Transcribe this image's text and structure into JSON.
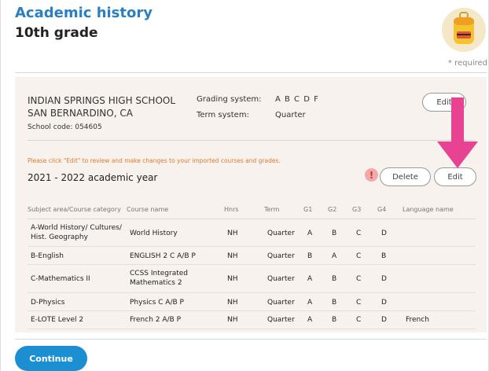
{
  "header": {
    "title": "Academic history",
    "subtitle": "10th grade",
    "required_note": "* required"
  },
  "school": {
    "name": "INDIAN SPRINGS HIGH SCHOOL",
    "city": "SAN BERNARDINO, CA",
    "code": "School code: 054605",
    "grading_label": "Grading system:",
    "grading_value": "A B C D F",
    "term_label": "Term system:",
    "term_value": "Quarter",
    "edit_label": "Edit"
  },
  "notice": "Please click \"Edit\" to review and make changes to your imported courses and grades.",
  "year": {
    "title": "2021 - 2022 academic year",
    "warning_icon": "!",
    "delete_label": "Delete",
    "edit_label": "Edit"
  },
  "table": {
    "headers": [
      "Subject area/Course category",
      "Course name",
      "Hnrs",
      "Term",
      "G1",
      "G2",
      "G3",
      "G4",
      "Language name"
    ],
    "rows": [
      {
        "subject": "A-World History/ Cultures/ Hist. Geography",
        "course": "World History",
        "hnrs": "NH",
        "term": "Quarter",
        "g1": "A",
        "g2": "B",
        "g3": "C",
        "g4": "D",
        "lang": ""
      },
      {
        "subject": "B-English",
        "course": "ENGLISH 2 C A/B P",
        "hnrs": "NH",
        "term": "Quarter",
        "g1": "B",
        "g2": "A",
        "g3": "C",
        "g4": "B",
        "lang": ""
      },
      {
        "subject": "C-Mathematics II",
        "course": "CCSS Integrated Mathematics 2",
        "hnrs": "NH",
        "term": "Quarter",
        "g1": "A",
        "g2": "B",
        "g3": "C",
        "g4": "D",
        "lang": ""
      },
      {
        "subject": "D-Physics",
        "course": "Physics C A/B P",
        "hnrs": "NH",
        "term": "Quarter",
        "g1": "A",
        "g2": "B",
        "g3": "C",
        "g4": "D",
        "lang": ""
      },
      {
        "subject": "E-LOTE Level 2",
        "course": "French 2 A/B P",
        "hnrs": "NH",
        "term": "Quarter",
        "g1": "A",
        "g2": "B",
        "g3": "C",
        "g4": "D",
        "lang": "French"
      }
    ]
  },
  "footer": {
    "continue_label": "Continue"
  },
  "colors": {
    "title_blue": "#2a7fc0",
    "notice_orange": "#e07a2b",
    "arrow_pink": "#e84393",
    "continue_blue": "#1b8fd2",
    "card_bg": "#f7f2ed"
  },
  "icons": {
    "avatar": "backpack-icon",
    "annotation": "down-arrow-icon",
    "warning": "warning-icon"
  }
}
